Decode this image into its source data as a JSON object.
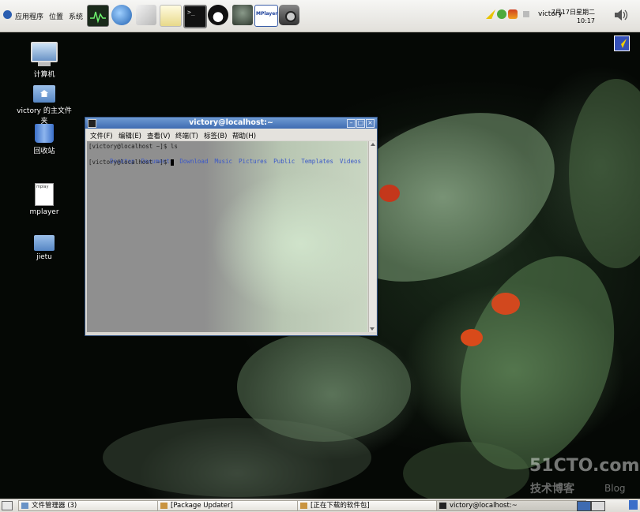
{
  "top_panel": {
    "menus": [
      "应用程序",
      "位置",
      "系统"
    ],
    "launchers": [
      "system-monitor-icon",
      "browser-icon",
      "text-editor-icon",
      "notes-icon",
      "terminal-icon",
      "qq-icon",
      "mplayer-launcher-icon",
      "mplayer-gui-icon",
      "screenshot-icon"
    ],
    "mplayer_badge": "MPlayer",
    "username": "victory",
    "clock_date": "7月17日星期二",
    "clock_time": "10:17"
  },
  "desktop_icons": [
    {
      "label": "计算机",
      "icon": "computer-icon"
    },
    {
      "label": "victory 的主文件夹",
      "icon": "home-folder-icon"
    },
    {
      "label": "回收站",
      "icon": "trash-icon"
    },
    {
      "label": "mplayer",
      "icon": "file-icon",
      "file_badge": "mplay"
    },
    {
      "label": "jietu",
      "icon": "folder-icon"
    }
  ],
  "terminal": {
    "title": "victory@localhost:~",
    "menu": [
      "文件(F)",
      "编辑(E)",
      "查看(V)",
      "终端(T)",
      "标签(B)",
      "帮助(H)"
    ],
    "line1": "[victory@localhost ~]$ ls",
    "ls_output": [
      "Desktop",
      "Documents",
      "Download",
      "Music",
      "Pictures",
      "Public",
      "Templates",
      "Videos"
    ],
    "line3": "[victory@localhost ~]$ "
  },
  "taskbar": {
    "items": [
      "文件管理器 (3)",
      "[Package Updater]",
      "[正在下载的软件包]",
      "victory@localhost:~"
    ]
  },
  "watermark": {
    "site": "51CTO.com",
    "tagline": "技术博客",
    "blog": "Blog"
  },
  "colors": {
    "accent": "#3e6bb1",
    "ls_dir": "#3a58c9"
  }
}
